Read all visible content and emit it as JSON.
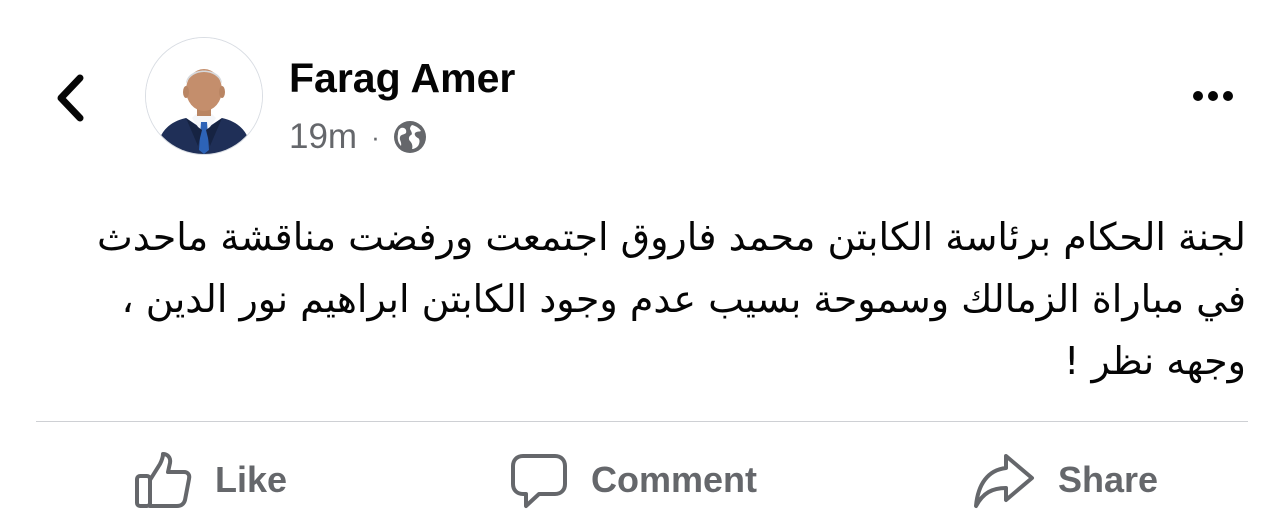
{
  "header": {
    "author_name": "Farag Amer",
    "timestamp": "19m",
    "separator": "·",
    "audience_icon": "globe-icon",
    "back_icon": "chevron-left-icon",
    "more_icon": "more-horizontal-icon"
  },
  "post": {
    "text": "لجنة الحكام برئاسة الكابتن محمد فاروق اجتمعت ورفضت مناقشة ماحدث في مباراة الزمالك وسموحة بسيب عدم وجود الكابتن ابراهيم نور الدين ، وجهه نظر !"
  },
  "actions": [
    {
      "label": "Like",
      "icon": "thumbs-up-icon"
    },
    {
      "label": "Comment",
      "icon": "comment-icon"
    },
    {
      "label": "Share",
      "icon": "share-arrow-icon"
    }
  ],
  "colors": {
    "primary_text": "#050505",
    "secondary_text": "#65676b",
    "divider": "#ced0d4",
    "background": "#ffffff"
  }
}
